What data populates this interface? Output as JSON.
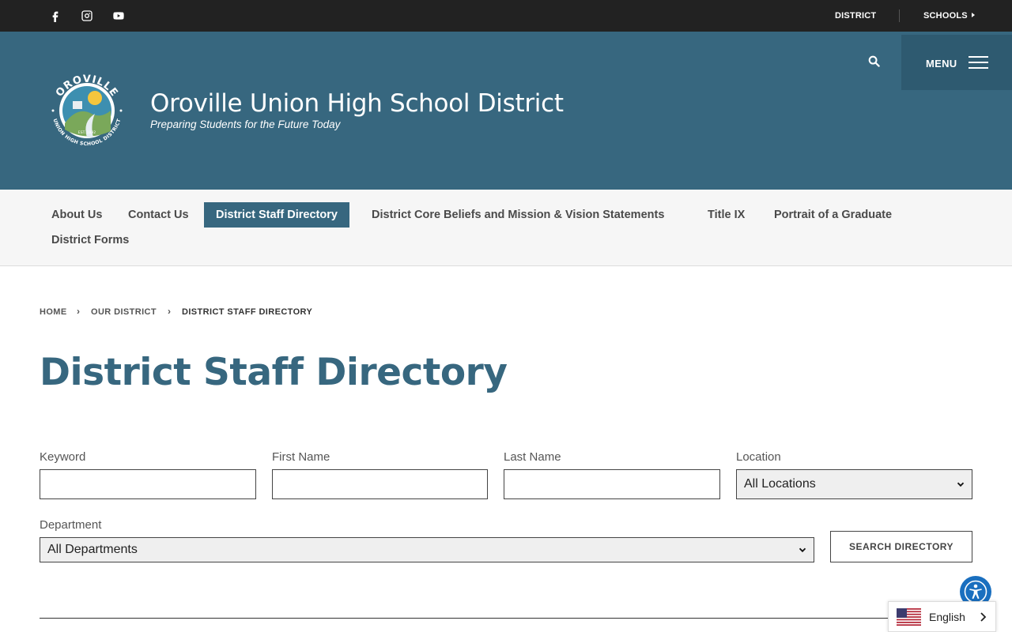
{
  "topbar": {
    "social": [
      {
        "name": "facebook-icon"
      },
      {
        "name": "instagram-icon"
      },
      {
        "name": "youtube-icon"
      }
    ],
    "district_label": "DISTRICT",
    "schools_label": "SCHOOLS"
  },
  "header": {
    "title": "Oroville Union High School District",
    "tagline": "Preparing Students for the Future Today",
    "menu_label": "MENU",
    "logo": {
      "top_text": "OROVILLE",
      "bottom_text": "UNION HIGH SCHOOL DISTRICT",
      "est": "EST. 1892"
    }
  },
  "subnav": {
    "items": [
      {
        "label": "About Us"
      },
      {
        "label": "Contact Us"
      },
      {
        "label": "District Staff Directory"
      },
      {
        "label": "District Core Beliefs and Mission & Vision Statements"
      },
      {
        "label": "Title IX"
      },
      {
        "label": "Portrait of a Graduate"
      },
      {
        "label": "District Forms"
      }
    ]
  },
  "breadcrumb": {
    "home": "HOME",
    "parent": "OUR DISTRICT",
    "current": "DISTRICT STAFF DIRECTORY"
  },
  "page": {
    "title": "District Staff Directory"
  },
  "form": {
    "keyword_label": "Keyword",
    "keyword_value": "",
    "first_name_label": "First Name",
    "first_name_value": "",
    "last_name_label": "Last Name",
    "last_name_value": "",
    "location_label": "Location",
    "location_value": "All Locations",
    "department_label": "Department",
    "department_value": "All Departments",
    "search_button": "SEARCH DIRECTORY"
  },
  "language": {
    "label": "English"
  },
  "colors": {
    "topbar": "#222222",
    "brand": "#37677f",
    "menu_bg": "#2e5a70",
    "subnav_bg": "#f6f6f6",
    "accessibility": "#1a6fbf"
  }
}
